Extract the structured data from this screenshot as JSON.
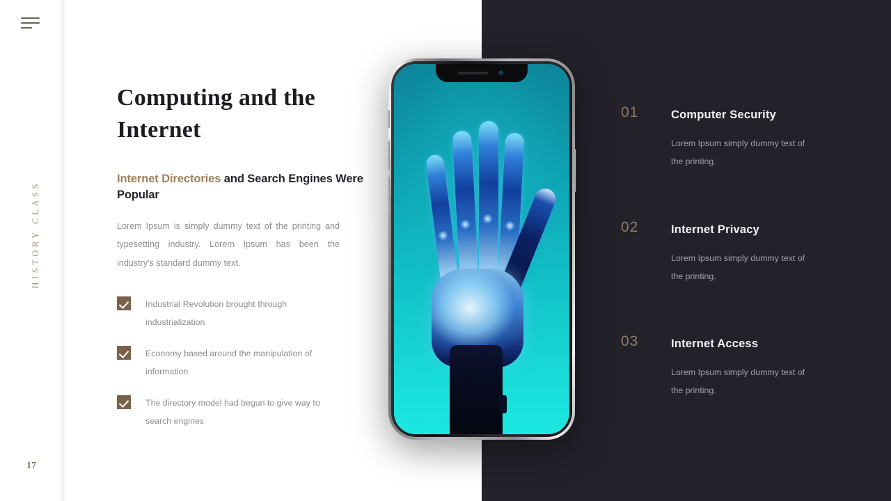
{
  "slide": {
    "page_number": "17",
    "rail_label": "HISTORY CLASS",
    "menu_icon": "hamburger-icon"
  },
  "left": {
    "headline": "Computing and the Internet",
    "subhead_accent": "Internet Directories",
    "subhead_rest": " and Search Engines Were Popular",
    "body": "Lorem Ipsum is simply dummy text of the printing and typesetting industry.  Lorem Ipsum has been the industry's standard dummy text.",
    "checklist": [
      {
        "text": "Industrial Revolution brought through industrialization"
      },
      {
        "text": "Economy based around the manipulation of information"
      },
      {
        "text": "The directory model had begun to give way to search engines"
      }
    ]
  },
  "right": {
    "features": [
      {
        "number": "01",
        "title": "Computer Security",
        "desc": "Lorem Ipsum simply dummy text of the printing."
      },
      {
        "number": "02",
        "title": "Internet Privacy",
        "desc": "Lorem Ipsum simply dummy text of the printing."
      },
      {
        "number": "03",
        "title": "Internet Access",
        "desc": "Lorem Ipsum simply dummy text of the printing."
      }
    ]
  },
  "phone": {
    "screen_subject": "robotic-hand-image",
    "notch_speaker": "earpiece-speaker",
    "notch_camera": "front-camera"
  },
  "colors": {
    "accent_brown": "#9c8059",
    "check_box": "#7a6248",
    "dark_panel": "#23222b",
    "number_gold": "#8e7a5f",
    "screen_teal": "#12c2c8",
    "hand_blue": "#2f7fd8"
  }
}
